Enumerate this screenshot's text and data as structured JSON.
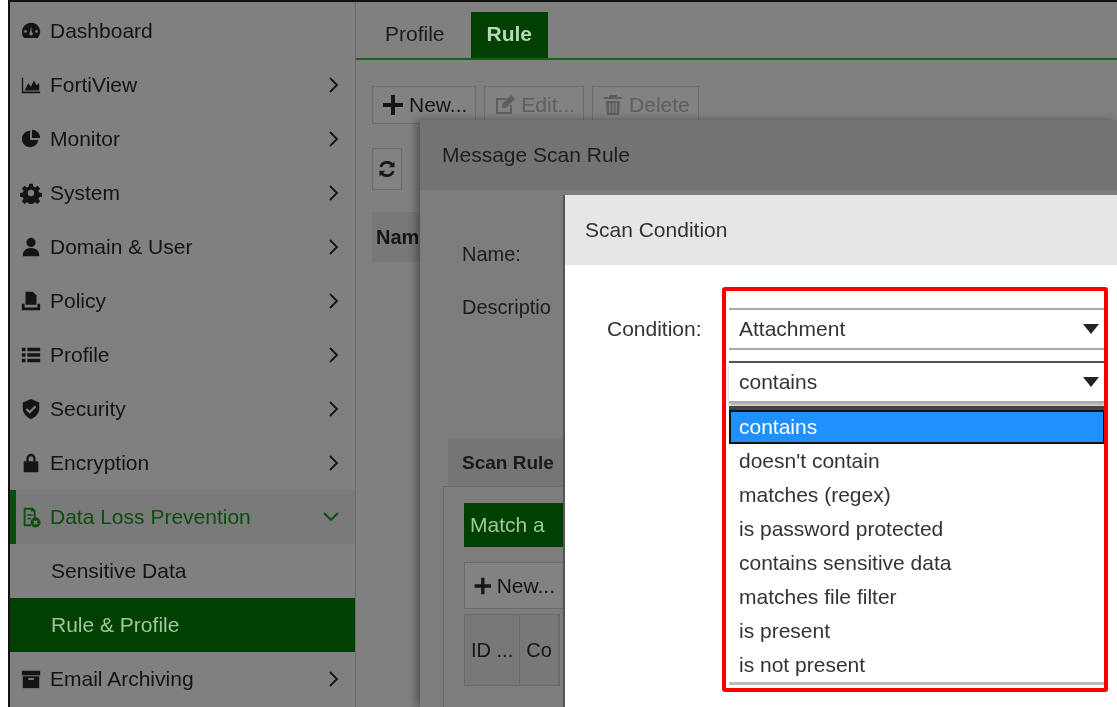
{
  "sidebar": {
    "items": [
      {
        "label": "Dashboard",
        "kind": "leaf"
      },
      {
        "label": "FortiView",
        "kind": "group",
        "expanded": false
      },
      {
        "label": "Monitor",
        "kind": "group",
        "expanded": false
      },
      {
        "label": "System",
        "kind": "group",
        "expanded": false
      },
      {
        "label": "Domain & User",
        "kind": "group",
        "expanded": false
      },
      {
        "label": "Policy",
        "kind": "group",
        "expanded": false
      },
      {
        "label": "Profile",
        "kind": "group",
        "expanded": false
      },
      {
        "label": "Security",
        "kind": "group",
        "expanded": false
      },
      {
        "label": "Encryption",
        "kind": "group",
        "expanded": false
      },
      {
        "label": "Data Loss Prevention",
        "kind": "group",
        "expanded": true,
        "children": [
          {
            "label": "Sensitive Data",
            "selected": false
          },
          {
            "label": "Rule & Profile",
            "selected": true
          }
        ]
      },
      {
        "label": "Email Archiving",
        "kind": "group",
        "expanded": false
      }
    ]
  },
  "tabs": [
    {
      "label": "Profile",
      "selected": false
    },
    {
      "label": "Rule",
      "selected": true
    }
  ],
  "toolbar": {
    "buttons": [
      {
        "label": "New...",
        "disabled": false
      },
      {
        "label": "Edit...",
        "disabled": true
      },
      {
        "label": "Delete",
        "disabled": true
      }
    ]
  },
  "table": {
    "columns": [
      "Nam"
    ]
  },
  "message_scan_rule": {
    "title": "Message Scan Rule",
    "fields": [
      {
        "label": "Name:"
      },
      {
        "label": "Descriptio"
      }
    ],
    "tabs": [
      {
        "label": "Scan Rule",
        "selected": true
      }
    ],
    "match_button": "Match a",
    "new_button": "New...",
    "columns": [
      "ID ...",
      "Co"
    ]
  },
  "scan_condition": {
    "title": "Scan Condition",
    "condition_label": "Condition:",
    "highlight": true,
    "selects": [
      {
        "value": "Attachment",
        "open": false
      },
      {
        "value": "contains",
        "open": true
      }
    ],
    "options": [
      {
        "label": "contains",
        "selected": true
      },
      {
        "label": "doesn't contain",
        "selected": false
      },
      {
        "label": "matches (regex)",
        "selected": false
      },
      {
        "label": "is password protected",
        "selected": false
      },
      {
        "label": "contains sensitive data",
        "selected": false
      },
      {
        "label": "matches file filter",
        "selected": false
      },
      {
        "label": "is present",
        "selected": false
      },
      {
        "label": "is not present",
        "selected": false
      }
    ]
  }
}
